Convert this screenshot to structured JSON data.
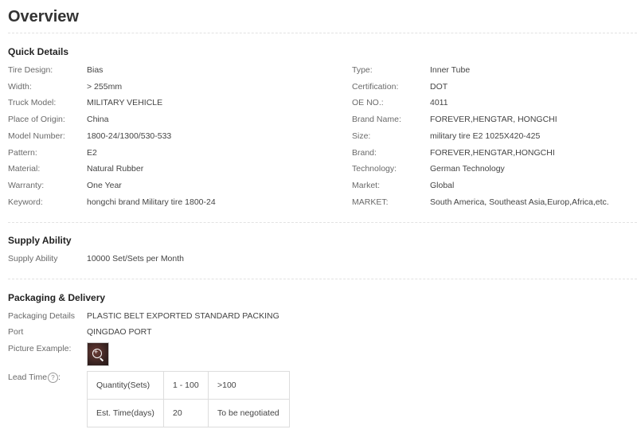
{
  "title": "Overview",
  "quick_details": {
    "heading": "Quick Details",
    "left": [
      {
        "label": "Tire Design:",
        "value": "Bias"
      },
      {
        "label": "Width:",
        "value": "> 255mm"
      },
      {
        "label": "Truck Model:",
        "value": "MILITARY VEHICLE"
      },
      {
        "label": "Place of Origin:",
        "value": "China"
      },
      {
        "label": "Model Number:",
        "value": "1800-24/1300/530-533"
      },
      {
        "label": "Pattern:",
        "value": "E2"
      },
      {
        "label": "Material:",
        "value": "Natural Rubber"
      },
      {
        "label": "Warranty:",
        "value": "One Year"
      },
      {
        "label": "Keyword:",
        "value": "hongchi brand Military tire 1800-24"
      }
    ],
    "right": [
      {
        "label": "Type:",
        "value": "Inner Tube"
      },
      {
        "label": "Certification:",
        "value": "DOT"
      },
      {
        "label": "OE NO.:",
        "value": "4011"
      },
      {
        "label": "Brand Name:",
        "value": "FOREVER,HENGTAR, HONGCHI"
      },
      {
        "label": "Size:",
        "value": "military tire E2 1025X420-425"
      },
      {
        "label": "Brand:",
        "value": "FOREVER,HENGTAR,HONGCHI"
      },
      {
        "label": "Technology:",
        "value": "German Technology"
      },
      {
        "label": "Market:",
        "value": "Global"
      },
      {
        "label": "MARKET:",
        "value": "South America, Southeast Asia,Europ,Africa,etc."
      }
    ]
  },
  "supply": {
    "heading": "Supply Ability",
    "label": "Supply Ability",
    "value": "10000 Set/Sets per Month"
  },
  "packaging": {
    "heading": "Packaging & Delivery",
    "details_label": "Packaging Details",
    "details_value": "PLASTIC BELT EXPORTED STANDARD PACKING",
    "port_label": "Port",
    "port_value": "QINGDAO PORT",
    "picture_label": "Picture Example:",
    "lead_label": "Lead Time",
    "help_glyph": "?",
    "lead_table": {
      "rows": [
        [
          "Quantity(Sets)",
          "1 - 100",
          ">100"
        ],
        [
          "Est. Time(days)",
          "20",
          "To be negotiated"
        ]
      ]
    }
  }
}
